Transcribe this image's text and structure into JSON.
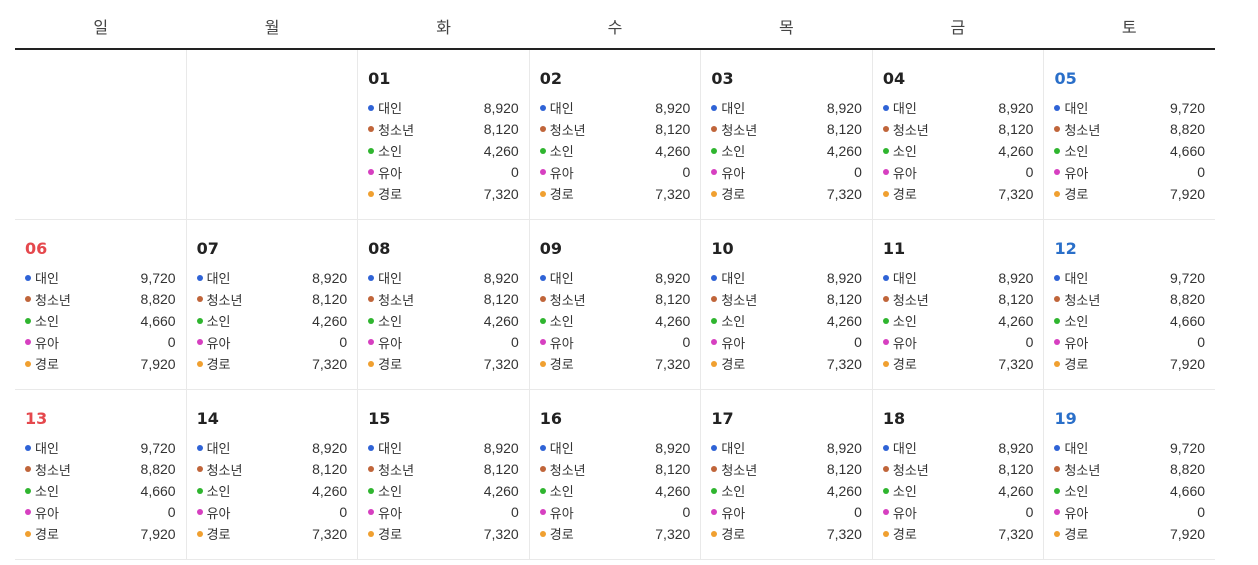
{
  "weekdays": [
    "일",
    "월",
    "화",
    "수",
    "목",
    "금",
    "토"
  ],
  "categories": [
    {
      "label": "대인",
      "color": "#2f63d6"
    },
    {
      "label": "청소년",
      "color": "#c0653a"
    },
    {
      "label": "소인",
      "color": "#2fb52f"
    },
    {
      "label": "유아",
      "color": "#d63fc0"
    },
    {
      "label": "경로",
      "color": "#f0a030"
    }
  ],
  "weeks": [
    [
      null,
      null,
      {
        "day": "01",
        "type": "weekday",
        "prices": [
          "8,920",
          "8,120",
          "4,260",
          "0",
          "7,320"
        ]
      },
      {
        "day": "02",
        "type": "weekday",
        "prices": [
          "8,920",
          "8,120",
          "4,260",
          "0",
          "7,320"
        ]
      },
      {
        "day": "03",
        "type": "weekday",
        "prices": [
          "8,920",
          "8,120",
          "4,260",
          "0",
          "7,320"
        ]
      },
      {
        "day": "04",
        "type": "weekday",
        "prices": [
          "8,920",
          "8,120",
          "4,260",
          "0",
          "7,320"
        ]
      },
      {
        "day": "05",
        "type": "sat",
        "prices": [
          "9,720",
          "8,820",
          "4,660",
          "0",
          "7,920"
        ]
      }
    ],
    [
      {
        "day": "06",
        "type": "sun",
        "prices": [
          "9,720",
          "8,820",
          "4,660",
          "0",
          "7,920"
        ]
      },
      {
        "day": "07",
        "type": "weekday",
        "prices": [
          "8,920",
          "8,120",
          "4,260",
          "0",
          "7,320"
        ]
      },
      {
        "day": "08",
        "type": "weekday",
        "prices": [
          "8,920",
          "8,120",
          "4,260",
          "0",
          "7,320"
        ]
      },
      {
        "day": "09",
        "type": "weekday",
        "prices": [
          "8,920",
          "8,120",
          "4,260",
          "0",
          "7,320"
        ]
      },
      {
        "day": "10",
        "type": "weekday",
        "prices": [
          "8,920",
          "8,120",
          "4,260",
          "0",
          "7,320"
        ]
      },
      {
        "day": "11",
        "type": "weekday",
        "prices": [
          "8,920",
          "8,120",
          "4,260",
          "0",
          "7,320"
        ]
      },
      {
        "day": "12",
        "type": "sat",
        "prices": [
          "9,720",
          "8,820",
          "4,660",
          "0",
          "7,920"
        ]
      }
    ],
    [
      {
        "day": "13",
        "type": "sun",
        "prices": [
          "9,720",
          "8,820",
          "4,660",
          "0",
          "7,920"
        ]
      },
      {
        "day": "14",
        "type": "weekday",
        "prices": [
          "8,920",
          "8,120",
          "4,260",
          "0",
          "7,320"
        ]
      },
      {
        "day": "15",
        "type": "weekday",
        "prices": [
          "8,920",
          "8,120",
          "4,260",
          "0",
          "7,320"
        ]
      },
      {
        "day": "16",
        "type": "weekday",
        "prices": [
          "8,920",
          "8,120",
          "4,260",
          "0",
          "7,320"
        ]
      },
      {
        "day": "17",
        "type": "weekday",
        "prices": [
          "8,920",
          "8,120",
          "4,260",
          "0",
          "7,320"
        ]
      },
      {
        "day": "18",
        "type": "weekday",
        "prices": [
          "8,920",
          "8,120",
          "4,260",
          "0",
          "7,320"
        ]
      },
      {
        "day": "19",
        "type": "sat",
        "prices": [
          "9,720",
          "8,820",
          "4,660",
          "0",
          "7,920"
        ]
      }
    ]
  ]
}
